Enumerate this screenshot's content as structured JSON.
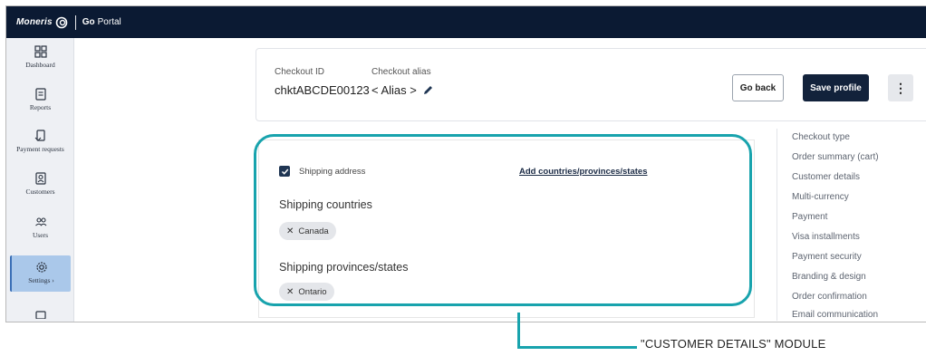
{
  "brand": {
    "name": "Moneris",
    "go": "Go",
    "portal": "Portal"
  },
  "sidebar": {
    "items": [
      {
        "label": "Dashboard",
        "icon": "dashboard-icon",
        "active": false
      },
      {
        "label": "Reports",
        "icon": "reports-icon",
        "active": false
      },
      {
        "label": "Payment requests",
        "icon": "payment-requests-icon",
        "active": false
      },
      {
        "label": "Customers",
        "icon": "customers-icon",
        "active": false
      },
      {
        "label": "Users",
        "icon": "users-icon",
        "active": false
      },
      {
        "label": "Settings ›",
        "icon": "gear-icon",
        "active": true
      }
    ]
  },
  "header": {
    "checkout_id_label": "Checkout ID",
    "checkout_id_value": "chktABCDE00123",
    "alias_label": "Checkout alias",
    "alias_value": "< Alias >",
    "go_back": "Go back",
    "save_profile": "Save profile",
    "more": "⋮"
  },
  "module": {
    "shipping_address_label": "Shipping address",
    "add_link": "Add countries/provinces/states",
    "countries_title": "Shipping countries",
    "countries": [
      "Canada"
    ],
    "provinces_title": "Shipping provinces/states",
    "provinces": [
      "Ontario"
    ]
  },
  "right_nav": [
    "Checkout type",
    "Order summary (cart)",
    "Customer details",
    "Multi-currency",
    "Payment",
    "Visa installments",
    "Payment security",
    "Branding & design",
    "Order confirmation",
    "Email communication"
  ],
  "annotation": {
    "callout": "\"CUSTOMER DETAILS\" MODULE",
    "color": "#18a3ad"
  }
}
